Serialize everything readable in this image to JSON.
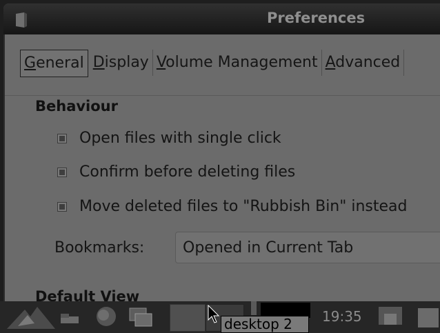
{
  "window": {
    "title": "Preferences"
  },
  "tabs": [
    {
      "label": "General",
      "mnemonic": "G",
      "rest": "eneral"
    },
    {
      "label": "Display",
      "mnemonic": "D",
      "rest": "isplay"
    },
    {
      "label": "Volume Management",
      "mnemonic": "V",
      "rest": "olume Management"
    },
    {
      "label": "Advanced",
      "mnemonic": "A",
      "rest": "dvanced"
    }
  ],
  "behaviour": {
    "title": "Behaviour",
    "options": [
      {
        "label": "Open files with single click",
        "checked": true
      },
      {
        "label": "Confirm before deleting files",
        "checked": true
      },
      {
        "label": "Move deleted files to \"Rubbish Bin\" instead",
        "checked": true
      }
    ],
    "bookmarks_label": "Bookmarks:",
    "bookmarks_value": "Opened in Current Tab"
  },
  "default_view": {
    "title": "Default View"
  },
  "taskbar": {
    "clock": "19:35",
    "tooltip": "desktop 2",
    "icons": [
      "lxde-menu-icon",
      "show-desktop-icon",
      "browser-icon",
      "window-switcher-icon",
      "desktop-pager",
      "volume-icon",
      "network-icon"
    ]
  }
}
